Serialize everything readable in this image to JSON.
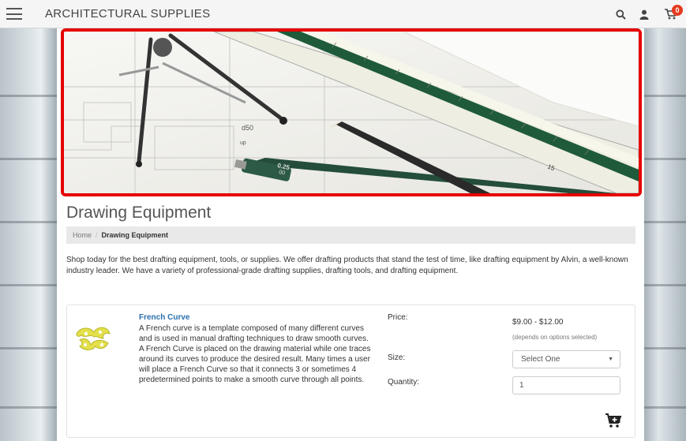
{
  "header": {
    "brand": "ARCHITECTURAL SUPPLIES",
    "cart_count": "0"
  },
  "page": {
    "title": "Drawing Equipment",
    "breadcrumb": {
      "home": "Home",
      "current": "Drawing Equipment"
    },
    "intro": "Shop today for the best drafting equipment, tools, or supplies. We offer drafting products that stand the test of time, like drafting equipment by Alvin, a well-known industry leader. We have a variety of professional-grade drafting supplies, drafting tools, and drafting equipment."
  },
  "product": {
    "name": "French Curve",
    "description": "A French curve is a template composed of many different curves and is used in manual drafting techniques to draw smooth curves. A French Curve is placed on the drawing material while one traces around its curves to produce the desired result. Many times a user will place a French Curve so that it connects 3 or sometimes 4 predetermined points to make a smooth curve through all points.",
    "price_label": "Price:",
    "price": "$9.00 - $12.00",
    "price_note": "(depends on options selected)",
    "size_label": "Size:",
    "size_selected": "Select One",
    "quantity_label": "Quantity:",
    "quantity": "1"
  },
  "banner_text": {
    "scale_marks": "15",
    "lead_size": "0.25",
    "lead_size_2": "00",
    "plan_label_1": "d50",
    "plan_label_2": "up"
  },
  "colors": {
    "brand_text": "#444444",
    "link": "#2a6fad",
    "cart_badge": "#e53a1e",
    "banner_border": "#e60000"
  },
  "icons": {
    "menu": "hamburger-icon",
    "search": "search-icon",
    "user": "user-icon",
    "cart": "cart-icon",
    "add_to_cart": "cart-plus-icon"
  }
}
